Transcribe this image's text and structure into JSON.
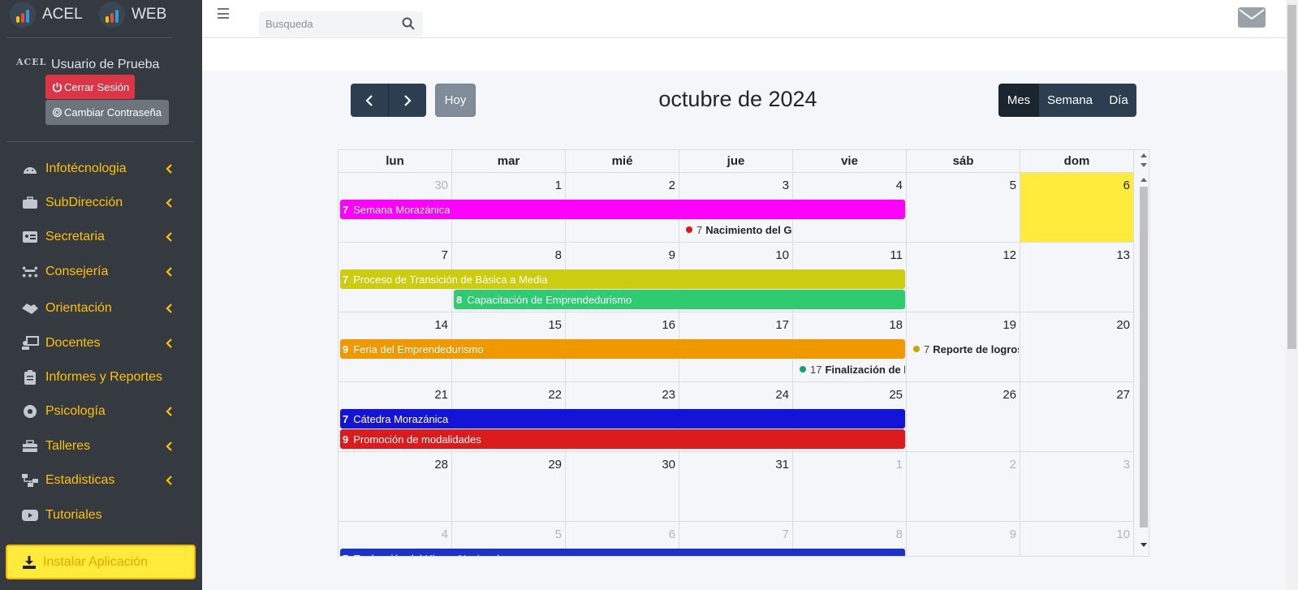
{
  "brand": {
    "left_name": "ACEL",
    "right_name": "WEB"
  },
  "user": {
    "logo_text": "ACEL",
    "name": "Usuario de Prueba",
    "logout_label": "Cerrar Sesión",
    "change_password_label": "Cambiar Contraseña"
  },
  "sidebar": {
    "items": [
      {
        "label": "Infotécnologia",
        "icon": "android-icon",
        "has_arrow": true
      },
      {
        "label": "SubDirección",
        "icon": "briefcase-icon",
        "has_arrow": true
      },
      {
        "label": "Secretaria",
        "icon": "id-card-icon",
        "has_arrow": true
      },
      {
        "label": "Consejería",
        "icon": "meeting-icon",
        "has_arrow": true
      },
      {
        "label": "Orientación",
        "icon": "handshake-icon",
        "has_arrow": true
      },
      {
        "label": "Docentes",
        "icon": "teacher-icon",
        "has_arrow": true
      },
      {
        "label": "Informes y Reportes",
        "icon": "clipboard-icon",
        "has_arrow": false
      },
      {
        "label": "Psicología",
        "icon": "brain-icon",
        "has_arrow": true
      },
      {
        "label": "Talleres",
        "icon": "toolbox-icon",
        "has_arrow": true
      },
      {
        "label": "Estadisticas",
        "icon": "sitemap-icon",
        "has_arrow": true
      },
      {
        "label": "Tutoriales",
        "icon": "youtube-icon",
        "has_arrow": false
      }
    ],
    "install_label": "Instalar Aplicación"
  },
  "search": {
    "placeholder": "Busqueda"
  },
  "calendar": {
    "title": "octubre de 2024",
    "today_label": "Hoy",
    "views": [
      "Mes",
      "Semana",
      "Día"
    ],
    "active_view": "Mes",
    "weekdays": [
      "lun",
      "mar",
      "mié",
      "jue",
      "vie",
      "sáb",
      "dom"
    ],
    "weeks": [
      {
        "days": [
          {
            "n": "30",
            "other": true
          },
          {
            "n": "1"
          },
          {
            "n": "2"
          },
          {
            "n": "3"
          },
          {
            "n": "4"
          },
          {
            "n": "5"
          },
          {
            "n": "6",
            "today": true
          }
        ]
      },
      {
        "days": [
          {
            "n": "7"
          },
          {
            "n": "8"
          },
          {
            "n": "9"
          },
          {
            "n": "10"
          },
          {
            "n": "11"
          },
          {
            "n": "12"
          },
          {
            "n": "13"
          }
        ]
      },
      {
        "days": [
          {
            "n": "14"
          },
          {
            "n": "15"
          },
          {
            "n": "16"
          },
          {
            "n": "17"
          },
          {
            "n": "18"
          },
          {
            "n": "19"
          },
          {
            "n": "20"
          }
        ]
      },
      {
        "days": [
          {
            "n": "21"
          },
          {
            "n": "22"
          },
          {
            "n": "23"
          },
          {
            "n": "24"
          },
          {
            "n": "25"
          },
          {
            "n": "26"
          },
          {
            "n": "27"
          }
        ]
      },
      {
        "days": [
          {
            "n": "28"
          },
          {
            "n": "29"
          },
          {
            "n": "30"
          },
          {
            "n": "31"
          },
          {
            "n": "1",
            "other": true
          },
          {
            "n": "2",
            "other": true
          },
          {
            "n": "3",
            "other": true
          }
        ]
      },
      {
        "days": [
          {
            "n": "4",
            "other": true
          },
          {
            "n": "5",
            "other": true
          },
          {
            "n": "6",
            "other": true
          },
          {
            "n": "7",
            "other": true
          },
          {
            "n": "8",
            "other": true
          },
          {
            "n": "9",
            "other": true
          },
          {
            "n": "10",
            "other": true
          }
        ]
      }
    ],
    "bar_events": [
      {
        "week": 0,
        "slot": 0,
        "start_col": 0,
        "span": 5,
        "time": "7",
        "title": "Semana Morazánica",
        "color": "#ff00ff"
      },
      {
        "week": 1,
        "slot": 0,
        "start_col": 0,
        "span": 5,
        "time": "7",
        "title": "Proceso de Transición de Básica a Media",
        "color": "#cccc11"
      },
      {
        "week": 1,
        "slot": 1,
        "start_col": 1,
        "span": 4,
        "time": "8",
        "title": "Capacitación de Emprendedurismo",
        "color": "#2ecc71"
      },
      {
        "week": 2,
        "slot": 0,
        "start_col": 0,
        "span": 5,
        "time": "9",
        "title": "Feria del Emprendedurismo",
        "color": "#f09800"
      },
      {
        "week": 3,
        "slot": 0,
        "start_col": 0,
        "span": 5,
        "time": "7",
        "title": "Cátedra Morazánica",
        "color": "#1414d9"
      },
      {
        "week": 3,
        "slot": 1,
        "start_col": 0,
        "span": 5,
        "time": "9",
        "title": "Promoción de modalidades",
        "color": "#dc1c1c"
      },
      {
        "week": 5,
        "slot": 0,
        "start_col": 0,
        "span": 5,
        "time": "7",
        "title": "Evaluación del Himno Nacional",
        "color": "#1a33cc"
      }
    ],
    "dot_events": [
      {
        "week": 0,
        "slot": 1,
        "col": 3,
        "time": "7",
        "title": "Nacimiento del Ge",
        "color": "#e81414"
      },
      {
        "week": 2,
        "slot": 0,
        "col": 5,
        "time": "7",
        "title": "Reporte de logros",
        "color": "#c4a800"
      },
      {
        "week": 2,
        "slot": 1,
        "col": 4,
        "time": "17",
        "title": "Finalización de la",
        "color": "#16a36a"
      }
    ]
  }
}
